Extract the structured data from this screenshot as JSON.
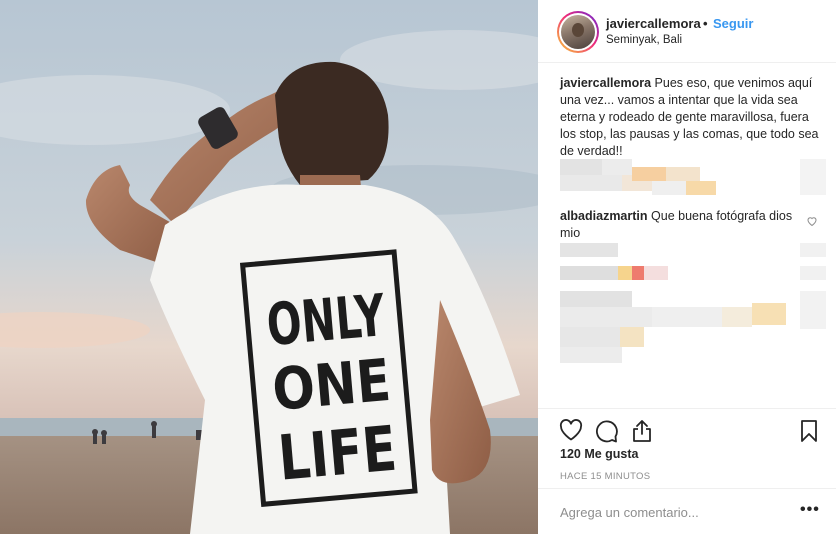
{
  "post": {
    "photo_shirt_text": [
      "ONLY",
      "ONE",
      "LIFE"
    ],
    "header": {
      "username": "javiercallemora",
      "separator": "•",
      "follow_label": "Seguir",
      "location": "Seminyak, Bali"
    },
    "caption": {
      "username": "javiercallemora",
      "text": "Pues eso, que venimos aquí una vez... vamos a intentar que la vida sea eterna y rodeado de gente maravillosa, fuera los stop, las pausas y las comas, que todo sea de verdad!!"
    },
    "comments": [
      {
        "username": "albadiazmartin",
        "text": "Que buena fotógrafa dios mio"
      }
    ],
    "likes_label": "120 Me gusta",
    "time_label": "HACE 15 MINUTOS",
    "comment_placeholder": "Agrega un comentario...",
    "more_label": "•••",
    "icons": [
      "heart-icon",
      "comment-icon",
      "share-icon",
      "bookmark-icon",
      "heart-small-icon"
    ],
    "colors": {
      "follow": "#3897f0",
      "muted": "#8e8e8e",
      "text": "#262626"
    }
  }
}
